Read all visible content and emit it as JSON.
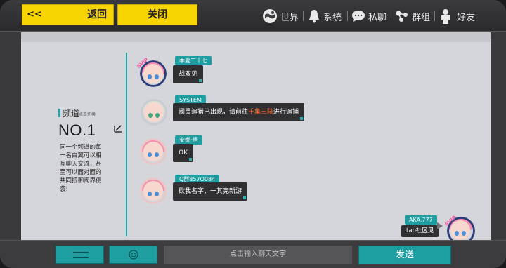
{
  "header": {
    "back_arrow": "<<",
    "back_label": "返回",
    "close_label": "关闭",
    "nav": [
      {
        "label": "世界",
        "icon": "globe-icon"
      },
      {
        "label": "系统",
        "icon": "bell-icon"
      },
      {
        "label": "私聊",
        "icon": "chat-icon"
      },
      {
        "label": "群组",
        "icon": "group-icon"
      },
      {
        "label": "好友",
        "icon": "person-icon"
      }
    ]
  },
  "channel": {
    "title": "频道",
    "hint": "点击切换",
    "number": "NO.1",
    "description": "同一个频道的每一名白翼可以相互聊天交流，甚至可以面对面的共同抵御阈界侵袭!"
  },
  "messages": [
    {
      "sender": "季夏二十七",
      "text": "战双见",
      "avatar": "pink-hair-svip"
    },
    {
      "sender": "SYSTEM",
      "text_before": "阈灵追猎已出现，请前往",
      "highlight": "千集三陆",
      "text_after": "进行追捕",
      "avatar": "white-hair"
    },
    {
      "sender": "安娜·悟",
      "text": "OK",
      "avatar": "pink-hair"
    },
    {
      "sender": "Q群857O084",
      "text": "砍我名字，一其完新游",
      "avatar": "pink-hair"
    }
  ],
  "self_message": {
    "sender": "AKA.777",
    "text": "tap社区见",
    "badge": "SVIP"
  },
  "badge_svip": "SVIP",
  "bottom": {
    "input_placeholder": "点击输入聊天文字",
    "send_label": "发送"
  },
  "colors": {
    "accent": "#1e9ea0",
    "yellow": "#f8d400",
    "highlight": "#ff6a2c"
  }
}
